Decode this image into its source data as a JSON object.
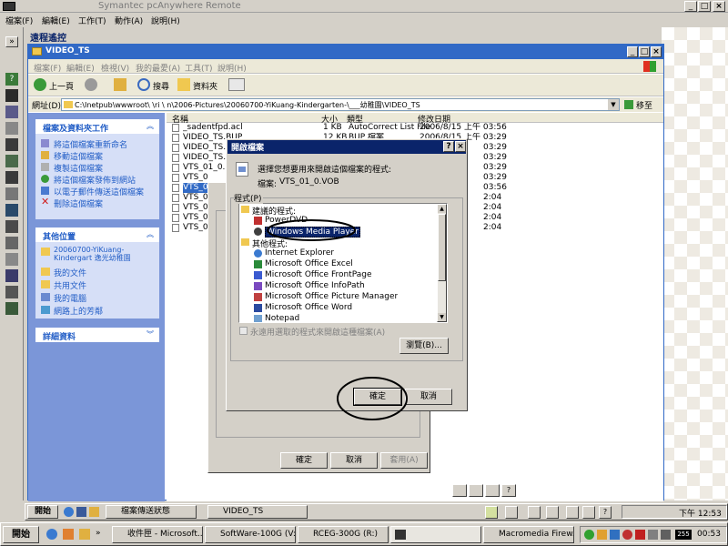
{
  "outer": {
    "title": "Symantec pcAnywhere Remote",
    "menu": [
      "檔案(F)",
      "編輯(E)",
      "工作(T)",
      "動作(A)",
      "說明(H)"
    ]
  },
  "remote_panel": {
    "title": "遠程遙控"
  },
  "explorer": {
    "title": "VIDEO_TS",
    "menu": [
      "檔案(F)",
      "編輯(E)",
      "檢視(V)",
      "我的最愛(A)",
      "工具(T)",
      "說明(H)"
    ],
    "toolbar": {
      "back": "上一頁",
      "search": "搜尋",
      "folders": "資料夾"
    },
    "address_label": "網址(D)",
    "address_value": "C:\\Inetpub\\wwwroot\\   \\ri    \\   n\\2006-Pictures\\20060700-YiKuang-Kindergarten-\\___幼稚園\\VIDEO_TS",
    "go": "移至",
    "tasks_title": "檔案及資料夾工作",
    "tasks": [
      "將這個檔案重新命名",
      "移動這個檔案",
      "複製這個檔案",
      "將這個檔案發佈到網站",
      "以電子郵件傳送這個檔案",
      "刪除這個檔案"
    ],
    "places_title": "其他位置",
    "places": [
      "20060700-YiKuang-Kindergart 逸光幼稚園",
      "我的文件",
      "共用文件",
      "我的電腦",
      "網路上的芳鄰"
    ],
    "details_title": "詳細資料",
    "columns": [
      "名稱",
      "大小",
      "類型",
      "修改日期"
    ],
    "files": [
      {
        "name": "_sadentfpd.acl",
        "size": "1 KB",
        "type": "AutoCorrect List File",
        "date": "2006/8/15 上午 03:56"
      },
      {
        "name": "VIDEO_TS.BUP",
        "size": "12 KB",
        "type": "BUP 檔案",
        "date": "2006/8/15 上午 03:29"
      },
      {
        "name": "VIDEO_TS.I",
        "size": "",
        "type": "",
        "date": "03:29"
      },
      {
        "name": "VIDEO_TS.V",
        "size": "",
        "type": "",
        "date": "03:29"
      },
      {
        "name": "VTS_01_0.I",
        "size": "",
        "type": "",
        "date": "03:29"
      },
      {
        "name": "VTS_0",
        "size": "",
        "type": "",
        "date": "03:29"
      },
      {
        "name": "VTS_0",
        "size": "",
        "type": "",
        "date": "03:56"
      },
      {
        "name": "VTS_0",
        "size": "",
        "type": "",
        "date": "2:04"
      },
      {
        "name": "VTS_0",
        "size": "",
        "type": "",
        "date": "2:04"
      },
      {
        "name": "VTS_0",
        "size": "",
        "type": "",
        "date": "2:04"
      },
      {
        "name": "VTS_0",
        "size": "",
        "type": "",
        "date": "2:04"
      }
    ]
  },
  "props_dialog": {
    "ok": "確定",
    "cancel": "取消",
    "apply": "套用(A)"
  },
  "open_with": {
    "title": "開啟檔案",
    "prompt": "選擇您想要用來開啟這個檔案的程式:",
    "file_label": "檔案:",
    "file_name": "VTS_01_0.VOB",
    "programs_label": "程式(P)",
    "recommended_label": "建議的程式:",
    "recommended": [
      "PowerDVD",
      "Windows Media Player"
    ],
    "other_label": "其他程式:",
    "other": [
      "Internet Explorer",
      "Microsoft Office Excel",
      "Microsoft Office FrontPage",
      "Microsoft Office InfoPath",
      "Microsoft Office Picture Manager",
      "Microsoft Office Word",
      "Notepad"
    ],
    "always_use": "永遠用選取的程式來開啟這種檔案(A)",
    "browse": "瀏覽(B)...",
    "ok": "確定",
    "cancel": "取消"
  },
  "remote_taskbar": {
    "start": "開始",
    "tasks": [
      "檔案傳送狀態",
      "VIDEO_TS"
    ],
    "time": "下午 12:53"
  },
  "taskbar": {
    "start": "開始",
    "tasks": [
      "收件匣 - Microsoft...",
      "SoftWare-100G (V:)",
      "RCEG-300G (R:)",
      "Macromedia Firew..."
    ],
    "time": "00:53",
    "tray_num": "255"
  },
  "colors": {
    "title_blue": "#0a246a",
    "xp_blue": "#3169c6",
    "selection": "#316ac5"
  }
}
